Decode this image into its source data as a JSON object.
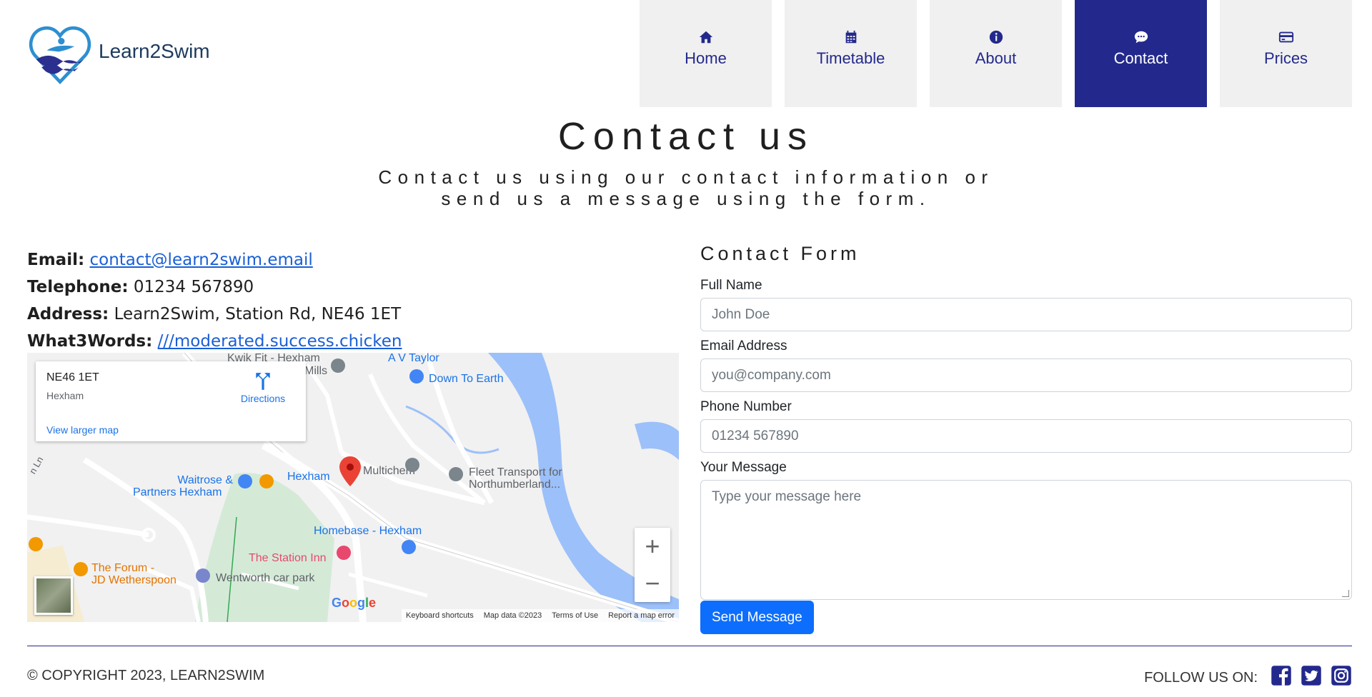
{
  "brand": {
    "name": "Learn2Swim"
  },
  "nav": [
    {
      "label": "Home",
      "icon": "home-icon"
    },
    {
      "label": "Timetable",
      "icon": "calendar-icon"
    },
    {
      "label": "About",
      "icon": "info-icon"
    },
    {
      "label": "Contact",
      "icon": "chat-icon",
      "active": true
    },
    {
      "label": "Prices",
      "icon": "credit-card-icon"
    }
  ],
  "colors": {
    "primary": "#23298c",
    "link": "#1a5fd6",
    "button": "#0d6efd",
    "nav_bg": "#f0f0f0"
  },
  "header": {
    "title": "Contact us",
    "subtitle": "Contact us using our contact information or send us a message using the form."
  },
  "contact": {
    "email_label": "Email:",
    "email": "contact@learn2swim.email",
    "phone_label": "Telephone:",
    "phone": "01234 567890",
    "address_label": "Address:",
    "address": "Learn2Swim, Station Rd, NE46 1ET",
    "w3w_label": "What3Words:",
    "w3w": "///moderated.success.chicken"
  },
  "map": {
    "card_address": "NE46 1ET",
    "card_town": "Hexham",
    "directions": "Directions",
    "larger_map": "View larger map",
    "labels": {
      "kwik_fit": "Kwik Fit - Hexham",
      "mills": "Mills",
      "av_taylor": "A V Taylor",
      "down_to_earth": "Down To Earth",
      "waitrose_1": "Waitrose &",
      "waitrose_2": "Partners Hexham",
      "hexham": "Hexham",
      "multichem": "Multichem",
      "fleet_1": "Fleet Transport for",
      "fleet_2": "Northumberland...",
      "homebase": "Homebase - Hexham",
      "station_inn": "The Station Inn",
      "forum_1": "The Forum -",
      "forum_2": "JD Wetherspoon",
      "car_park": "Wentworth car park",
      "ln": "n Ln"
    },
    "google": "Google",
    "footer": [
      "Keyboard shortcuts",
      "Map data ©2023",
      "Terms of Use",
      "Report a map error"
    ],
    "zoom_in": "+",
    "zoom_out": "−"
  },
  "form": {
    "title": "Contact Form",
    "name_label": "Full Name",
    "name_placeholder": "John Doe",
    "email_label": "Email Address",
    "email_placeholder": "you@company.com",
    "phone_label": "Phone Number",
    "phone_placeholder": "01234 567890",
    "message_label": "Your Message",
    "message_placeholder": "Type your message here",
    "submit": "Send Message"
  },
  "footer": {
    "copyright": "© COPYRIGHT 2023, LEARN2SWIM",
    "follow": "FOLLOW US ON:",
    "socials": [
      "facebook-icon",
      "twitter-icon",
      "instagram-icon"
    ]
  }
}
